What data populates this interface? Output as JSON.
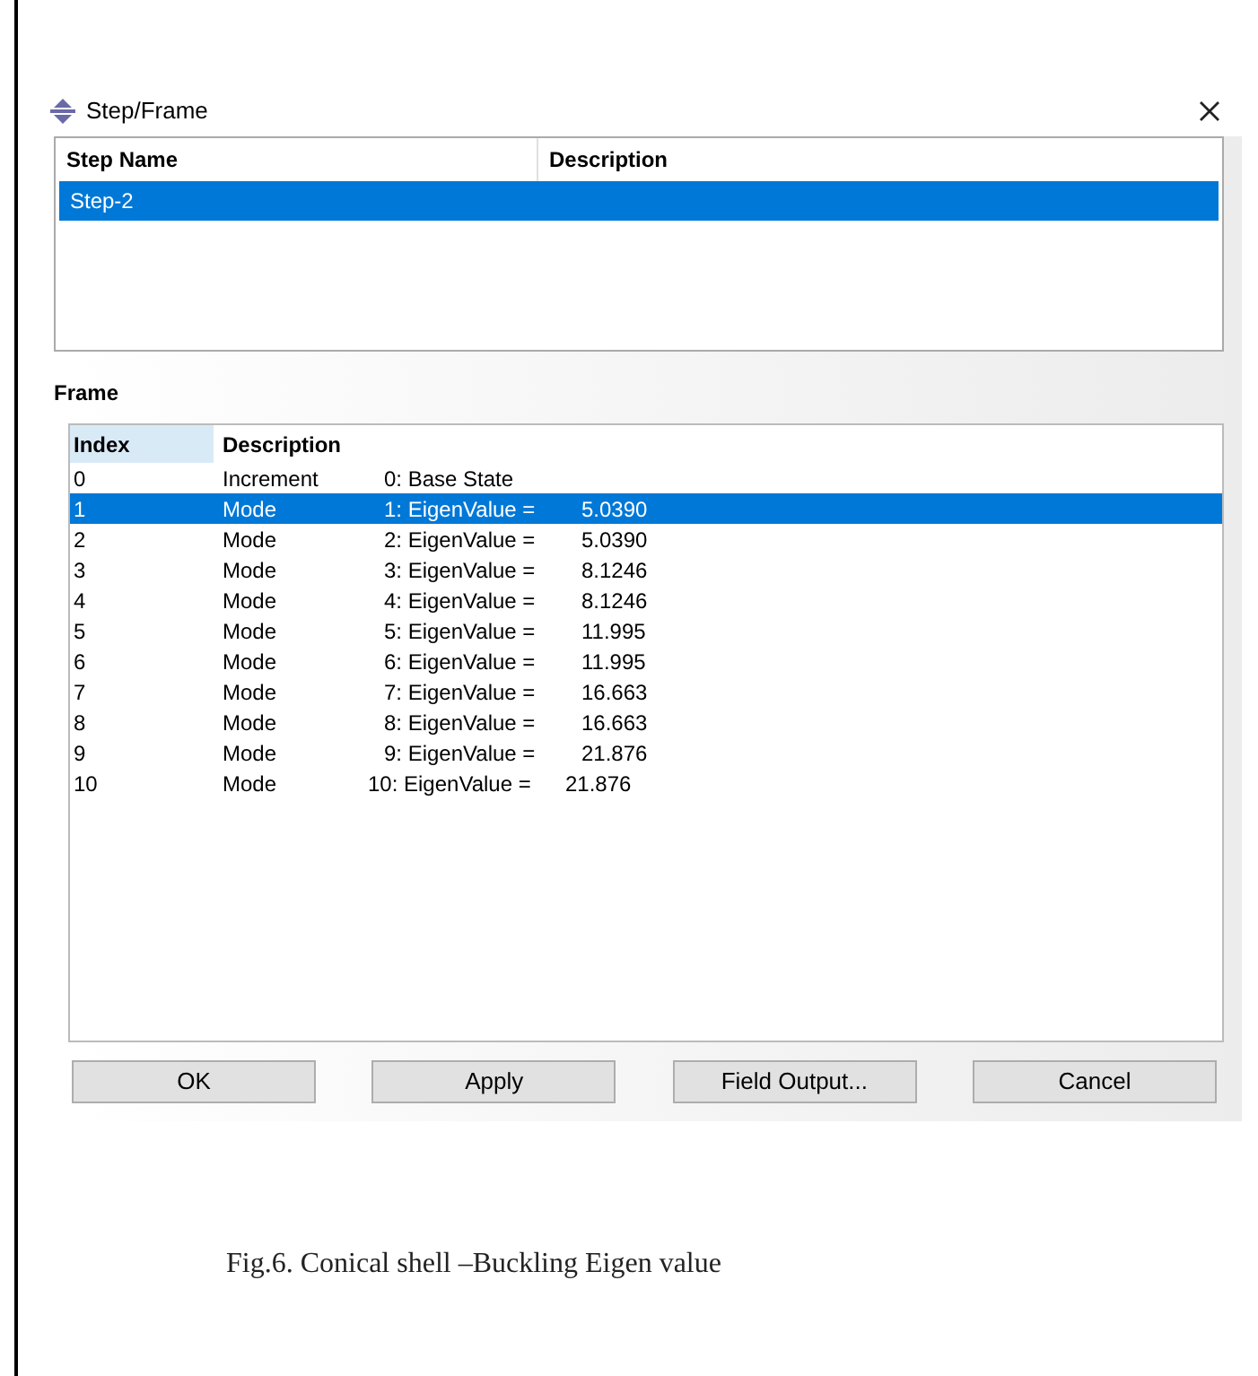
{
  "window": {
    "title": "Step/Frame"
  },
  "step_table": {
    "columns": [
      "Step Name",
      "Description"
    ],
    "rows": [
      {
        "step_name": "Step-2",
        "selected": true
      }
    ]
  },
  "frame_label": "Frame",
  "frame_table": {
    "columns": [
      "Index",
      "Description"
    ],
    "rows": [
      {
        "index": "0",
        "type": "Increment",
        "label": "0: Base State",
        "selected": false
      },
      {
        "index": "1",
        "type": "Mode",
        "label": "1: EigenValue =",
        "value": "5.0390",
        "selected": true
      },
      {
        "index": "2",
        "type": "Mode",
        "label": "2: EigenValue =",
        "value": "5.0390",
        "selected": false
      },
      {
        "index": "3",
        "type": "Mode",
        "label": "3: EigenValue =",
        "value": "8.1246",
        "selected": false
      },
      {
        "index": "4",
        "type": "Mode",
        "label": "4: EigenValue =",
        "value": "8.1246",
        "selected": false
      },
      {
        "index": "5",
        "type": "Mode",
        "label": "5: EigenValue =",
        "value": "11.995",
        "selected": false
      },
      {
        "index": "6",
        "type": "Mode",
        "label": "6: EigenValue =",
        "value": "11.995",
        "selected": false
      },
      {
        "index": "7",
        "type": "Mode",
        "label": "7: EigenValue =",
        "value": "16.663",
        "selected": false
      },
      {
        "index": "8",
        "type": "Mode",
        "label": "8: EigenValue =",
        "value": "16.663",
        "selected": false
      },
      {
        "index": "9",
        "type": "Mode",
        "label": "9: EigenValue =",
        "value": "21.876",
        "selected": false
      },
      {
        "index": "10",
        "type": "Mode",
        "label": "10: EigenValue =",
        "value": "21.876",
        "selected": false
      }
    ]
  },
  "buttons": [
    "OK",
    "Apply",
    "Field Output...",
    "Cancel"
  ],
  "caption": "Fig.6. Conical shell –Buckling Eigen value"
}
